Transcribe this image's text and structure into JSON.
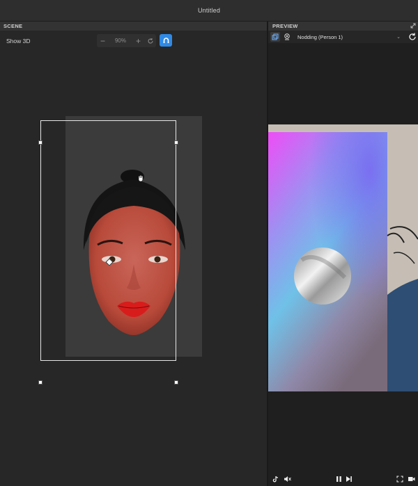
{
  "window": {
    "title": "Untitled"
  },
  "scene": {
    "header": "SCENE",
    "show3d_label": "Show 3D",
    "zoom": {
      "value": "90%",
      "minus": "−",
      "plus": "+"
    }
  },
  "preview": {
    "header": "PREVIEW",
    "effect_dropdown": "Nodding (Person 1)"
  },
  "colors": {
    "accent": "#2f8ae6",
    "panel_bg": "#272727",
    "preview_bg": "#1f1f1f"
  },
  "icons": {
    "expand": "expand-icon",
    "layers": "layers-icon",
    "webcam": "webcam-icon",
    "refresh": "refresh-icon",
    "magnet": "magnet-icon",
    "tiktok": "tiktok-icon",
    "mute": "mute-icon",
    "pause": "pause-icon",
    "step": "step-forward-icon",
    "fullscreen": "fullscreen-icon",
    "record": "record-icon"
  }
}
